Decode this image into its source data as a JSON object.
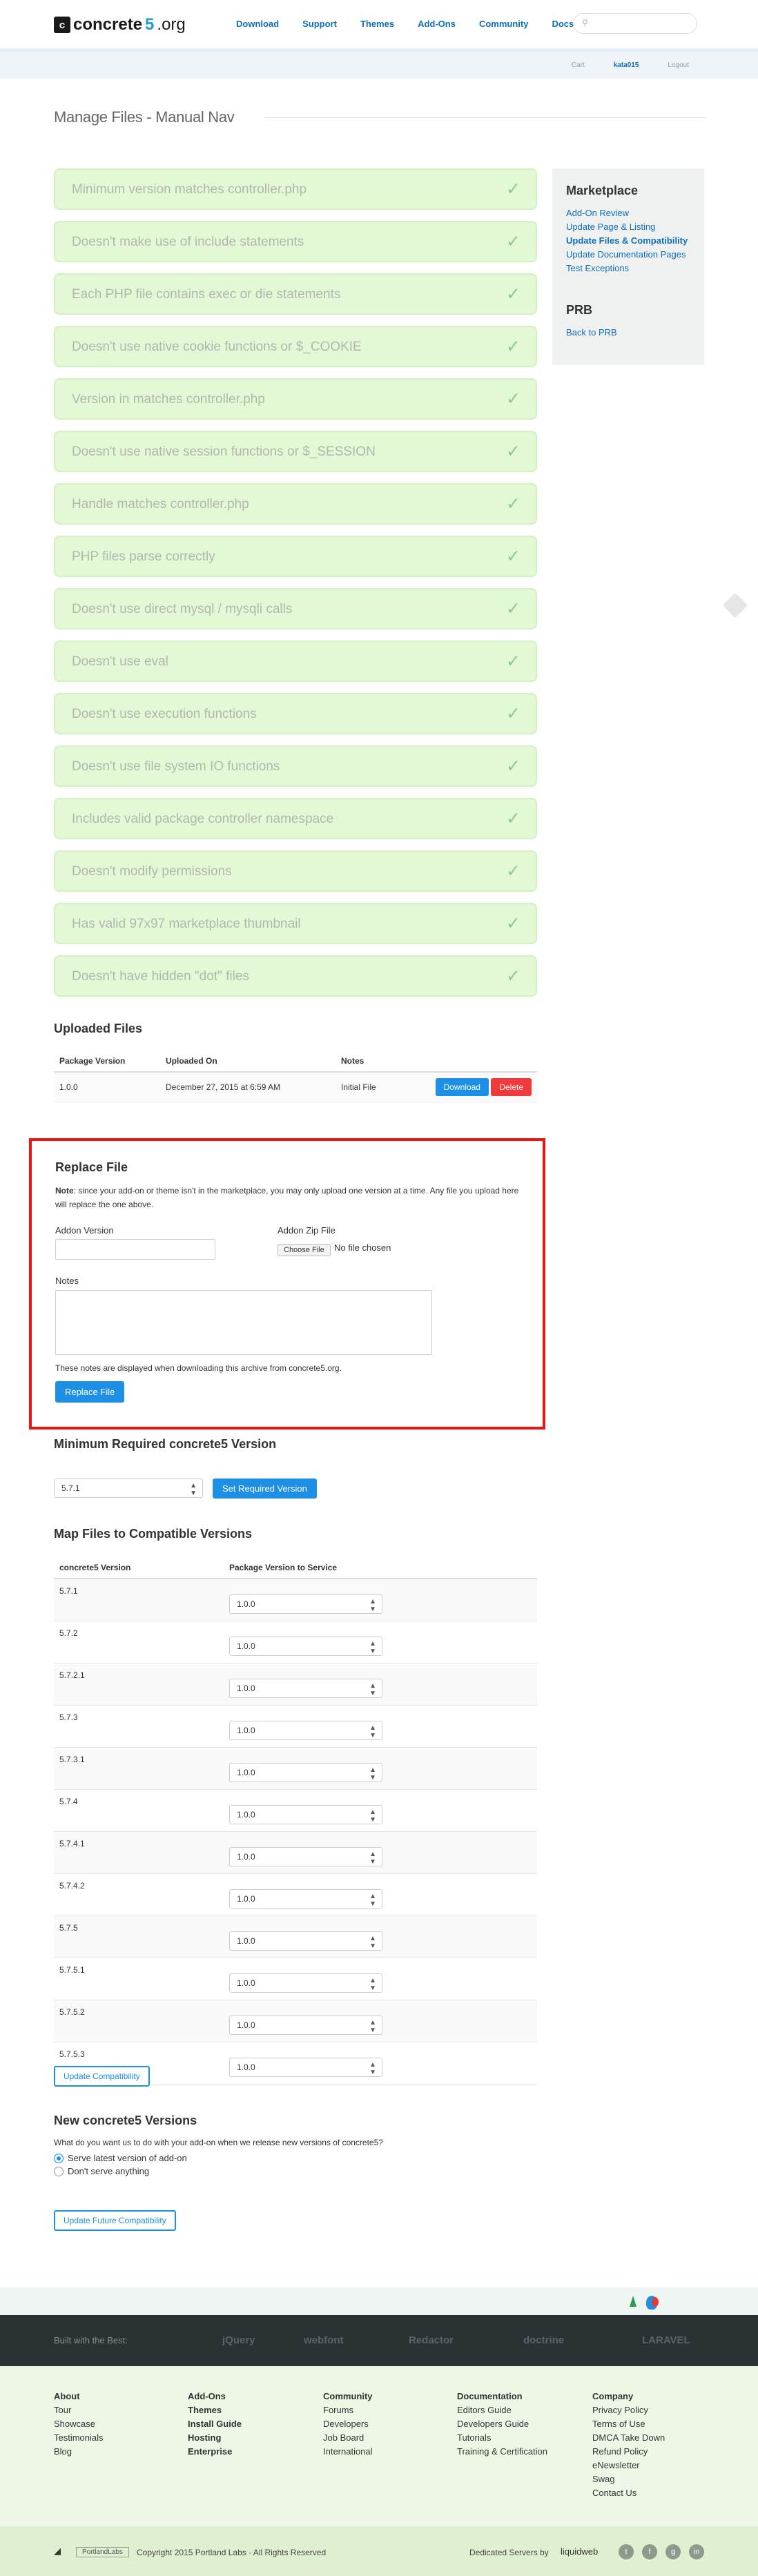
{
  "logo": {
    "brand": "concrete",
    "five": "5",
    "org": ".org"
  },
  "topnav": [
    "Download",
    "Support",
    "Themes",
    "Add-Ons",
    "Community",
    "Docs"
  ],
  "bar": {
    "cart": "Cart",
    "user": "kata015",
    "logout": "Logout"
  },
  "page_title": "Manage Files - Manual Nav",
  "checks": [
    "Minimum version matches controller.php",
    "Doesn't make use of include statements",
    "Each PHP file contains exec or die statements",
    "Doesn't use native cookie functions or $_COOKIE",
    "Version in matches controller.php",
    "Doesn't use native session functions or $_SESSION",
    "Handle matches controller.php",
    "PHP files parse correctly",
    "Doesn't use direct mysql / mysqli calls",
    "Doesn't use eval",
    "Doesn't use execution functions",
    "Doesn't use file system IO functions",
    "Includes valid package controller namespace",
    "Doesn't modify permissions",
    "Has valid 97x97 marketplace thumbnail",
    "Doesn't have hidden \"dot\" files"
  ],
  "check_mark": "✓",
  "sidebar": {
    "title": "Marketplace",
    "links": [
      "Add-On Review",
      "Update Page & Listing",
      "Update Files & Compatibility",
      "Update Documentation Pages",
      "Test Exceptions"
    ],
    "title2": "PRB",
    "links2": [
      "Back to PRB"
    ]
  },
  "uploaded": {
    "title": "Uploaded Files",
    "headers": [
      "Package Version",
      "Uploaded On",
      "Notes"
    ],
    "row": {
      "version": "1.0.0",
      "date": "December 27, 2015 at 6:59 AM",
      "notes": "Initial File",
      "download": "Download",
      "delete": "Delete"
    }
  },
  "replace": {
    "title": "Replace File",
    "note_bold": "Note",
    "note": ": since your add-on or theme isn't in the marketplace, you may only upload one version at a time. Any file you upload here will replace the one above.",
    "addon_version": "Addon Version",
    "addon_zip": "Addon Zip File",
    "choose_file": "Choose File",
    "no_file": "No file chosen",
    "notes": "Notes",
    "help": "These notes are displayed when downloading this archive from concrete5.org.",
    "button": "Replace File"
  },
  "minreq": {
    "title": "Minimum Required concrete5 Version",
    "value": "5.7.1",
    "button": "Set Required Version"
  },
  "map": {
    "title": "Map Files to Compatible Versions",
    "headers": [
      "concrete5 Version",
      "Package Version to Service"
    ],
    "rows": [
      {
        "v": "5.7.1",
        "p": "1.0.0"
      },
      {
        "v": "5.7.2",
        "p": "1.0.0"
      },
      {
        "v": "5.7.2.1",
        "p": "1.0.0"
      },
      {
        "v": "5.7.3",
        "p": "1.0.0"
      },
      {
        "v": "5.7.3.1",
        "p": "1.0.0"
      },
      {
        "v": "5.7.4",
        "p": "1.0.0"
      },
      {
        "v": "5.7.4.1",
        "p": "1.0.0"
      },
      {
        "v": "5.7.4.2",
        "p": "1.0.0"
      },
      {
        "v": "5.7.5",
        "p": "1.0.0"
      },
      {
        "v": "5.7.5.1",
        "p": "1.0.0"
      },
      {
        "v": "5.7.5.2",
        "p": "1.0.0"
      },
      {
        "v": "5.7.5.3",
        "p": "1.0.0"
      }
    ],
    "button": "Update Compatibility"
  },
  "newver": {
    "title": "New concrete5 Versions",
    "question": "What do you want us to do with your add-on when we release new versions of concrete5?",
    "opt1": "Serve latest version of add-on",
    "opt2": "Don't serve anything",
    "button": "Update Future Compatibility"
  },
  "built": {
    "label": "Built with the Best:",
    "logos": [
      "jQuery",
      "webfont",
      "Redactor",
      "doctrine",
      "LARAVEL"
    ]
  },
  "footer": [
    {
      "h": "About",
      "items": [
        "Tour",
        "Showcase",
        "Testimonials",
        "Blog"
      ]
    },
    {
      "h": "Add-Ons",
      "items": [
        "Themes",
        "Install Guide",
        "Hosting",
        "Enterprise"
      ]
    },
    {
      "h": "Community",
      "items": [
        "Forums",
        "Developers",
        "Job Board",
        "International"
      ]
    },
    {
      "h": "Documentation",
      "items": [
        "Editors Guide",
        "Developers Guide",
        "Tutorials",
        "Training & Certification"
      ]
    },
    {
      "h": "Company",
      "items": [
        "Privacy Policy",
        "Terms of Use",
        "DMCA Take Down",
        "Refund Policy",
        "eNewsletter",
        "Swag",
        "Contact Us"
      ]
    }
  ],
  "bottom": {
    "portland": "PortlandLabs",
    "copyright": "Copyright 2015 Portland Labs  ·  All Rights Reserved",
    "dedicated": "Dedicated Servers by",
    "host": "liquidweb",
    "social": [
      "t",
      "f",
      "g",
      "in"
    ]
  },
  "colors": {
    "accent": "#1d8fe4",
    "check_bg": "#e3f9d6",
    "highlight": "#ee1212"
  }
}
